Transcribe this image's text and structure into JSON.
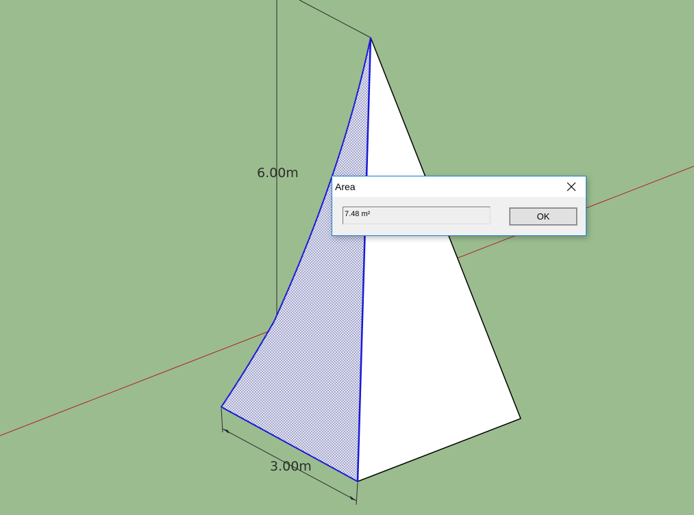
{
  "model": {
    "height_dimension": "6.00m",
    "width_dimension": "3.00m"
  },
  "dialog": {
    "title": "Area",
    "value": "7.48 m²",
    "ok_label": "OK"
  },
  "colors": {
    "background": "#9bbc8f",
    "red_axis": "#b02020",
    "selection_blue": "#1a1ad6",
    "face_white": "#ffffff",
    "dialog_border": "#1883d7"
  }
}
